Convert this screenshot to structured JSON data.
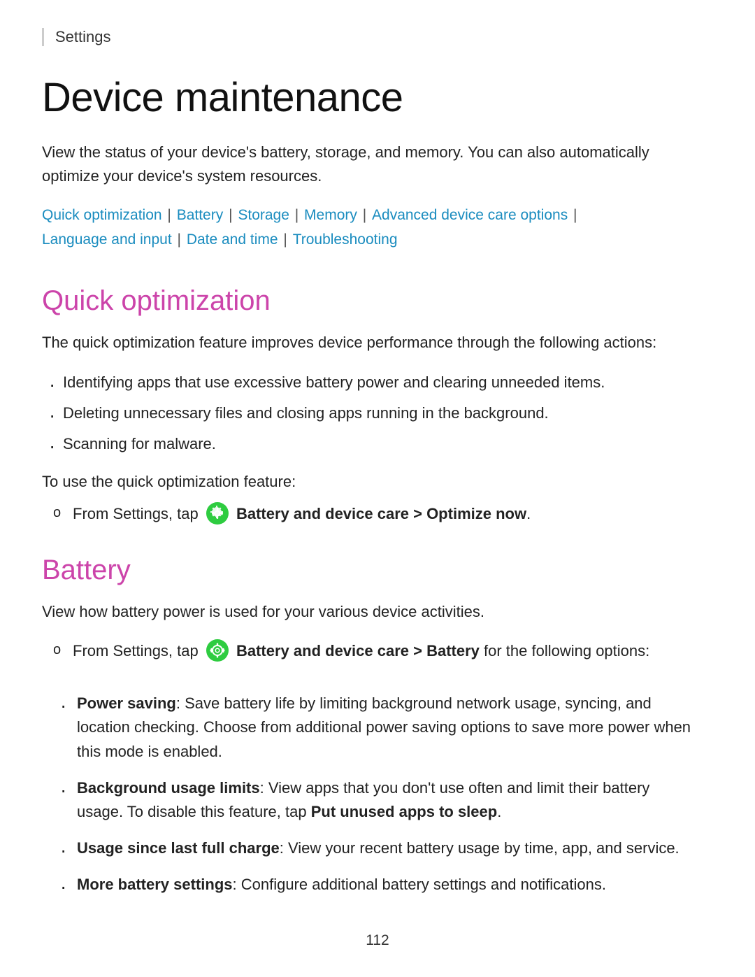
{
  "breadcrumb": {
    "label": "Settings"
  },
  "page": {
    "title": "Device maintenance",
    "intro": "View the status of your device's battery, storage, and memory. You can also automatically optimize your device's system resources."
  },
  "nav": {
    "links": [
      {
        "label": "Quick optimization",
        "href": "#quick-optimization"
      },
      {
        "label": "Battery",
        "href": "#battery"
      },
      {
        "label": "Storage",
        "href": "#storage"
      },
      {
        "label": "Memory",
        "href": "#memory"
      },
      {
        "label": "Advanced device care options",
        "href": "#advanced"
      },
      {
        "label": "Language and input",
        "href": "#language"
      },
      {
        "label": "Date and time",
        "href": "#datetime"
      },
      {
        "label": "Troubleshooting",
        "href": "#troubleshooting"
      }
    ]
  },
  "sections": {
    "quick_optimization": {
      "title": "Quick optimization",
      "intro": "The quick optimization feature improves device performance through the following actions:",
      "bullets": [
        "Identifying apps that use excessive battery power and clearing unneeded items.",
        "Deleting unnecessary files and closing apps running in the background.",
        "Scanning for malware."
      ],
      "to_use": "To use the quick optimization feature:",
      "steps": [
        {
          "text_before": "From Settings, tap",
          "bold": "Battery and device care > Optimize now",
          "text_after": "."
        }
      ]
    },
    "battery": {
      "title": "Battery",
      "intro": "View how battery power is used for your various device activities.",
      "steps": [
        {
          "text_before": "From Settings, tap",
          "bold": "Battery and device care > Battery",
          "text_after": " for the following options:"
        }
      ],
      "sub_bullets": [
        {
          "bold": "Power saving",
          "text": ": Save battery life by limiting background network usage, syncing, and location checking. Choose from additional power saving options to save more power when this mode is enabled."
        },
        {
          "bold": "Background usage limits",
          "text": ": View apps that you don't use often and limit their battery usage. To disable this feature, tap ",
          "bold2": "Put unused apps to sleep",
          "text2": "."
        },
        {
          "bold": "Usage since last full charge",
          "text": ": View your recent battery usage by time, app, and service."
        },
        {
          "bold": "More battery settings",
          "text": ": Configure additional battery settings and notifications."
        }
      ]
    }
  },
  "footer": {
    "page_number": "112"
  }
}
